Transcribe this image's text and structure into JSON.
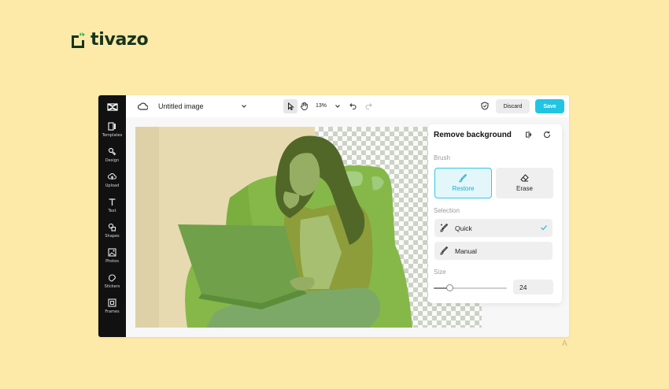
{
  "brand": {
    "name": "tivazo",
    "logo_color": "#2fb344"
  },
  "watermark": {
    "glyph": "A"
  },
  "sidebar": {
    "logo": "capcut-logo-icon",
    "items": [
      {
        "label": "Templates",
        "icon": "templates-icon"
      },
      {
        "label": "Design",
        "icon": "design-icon"
      },
      {
        "label": "Upload",
        "icon": "upload-icon"
      },
      {
        "label": "Text",
        "icon": "text-icon"
      },
      {
        "label": "Shapes",
        "icon": "shapes-icon"
      },
      {
        "label": "Photos",
        "icon": "photos-icon"
      },
      {
        "label": "Stickers",
        "icon": "stickers-icon"
      },
      {
        "label": "Frames",
        "icon": "frames-icon"
      }
    ]
  },
  "topbar": {
    "doc_title": "Untitled image",
    "zoom": "13%",
    "discard_label": "Discard",
    "save_label": "Save",
    "save_color": "#21c5e3"
  },
  "panel": {
    "title": "Remove background",
    "brush_label": "Brush",
    "brush_options": [
      {
        "label": "Restore",
        "selected": true
      },
      {
        "label": "Erase",
        "selected": false
      }
    ],
    "selection_label": "Selection",
    "selection_options": [
      {
        "label": "Quick",
        "selected": true
      },
      {
        "label": "Manual",
        "selected": false
      }
    ],
    "size_label": "Size",
    "size_value": "24",
    "size_fraction": 0.22,
    "accent_color": "#35c6e2"
  }
}
